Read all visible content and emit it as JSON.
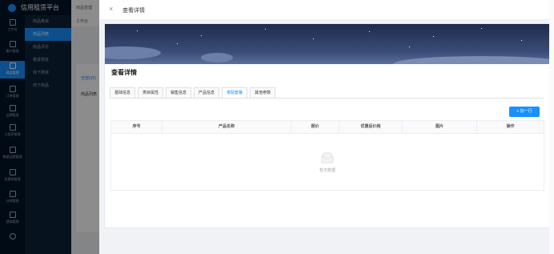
{
  "app": {
    "title": "信用租赁平台"
  },
  "rail": [
    {
      "label": "工作台"
    },
    {
      "label": "客户管理"
    },
    {
      "label": "商品管理"
    },
    {
      "label": "订单管理"
    },
    {
      "label": "品牌管理"
    },
    {
      "label": "小程序管理"
    },
    {
      "label": "数据运营管理"
    },
    {
      "label": "优惠卷管理"
    },
    {
      "label": "分销管理"
    },
    {
      "label": "营销管理"
    }
  ],
  "submenu": [
    {
      "label": "商品类目"
    },
    {
      "label": "商品列表"
    },
    {
      "label": "商品评论"
    },
    {
      "label": "租赁规定"
    },
    {
      "label": "线下类目"
    },
    {
      "label": "线下商品"
    }
  ],
  "background": {
    "breadcrumb": "商品管理",
    "tab": "工作台",
    "filter_tab": "全部(30)",
    "list_title": "商品列表"
  },
  "drawer": {
    "header_title": "查看详情",
    "detail_title": "查看详情",
    "tabs": [
      {
        "label": "基础信息"
      },
      {
        "label": "类目属性"
      },
      {
        "label": "销售信息"
      },
      {
        "label": "产品信息"
      },
      {
        "label": "搭配套餐"
      },
      {
        "label": "其他参数"
      }
    ],
    "active_tab": "搭配套餐",
    "add_button": "+ 加一行",
    "table": {
      "columns": [
        "序号",
        "产品名称",
        "报价",
        "优惠后价格",
        "图片",
        "操作"
      ],
      "empty_text": "暂无数据"
    }
  },
  "colors": {
    "primary": "#1890ff",
    "sidebar": "#001529",
    "banner": "#3b4d78"
  }
}
